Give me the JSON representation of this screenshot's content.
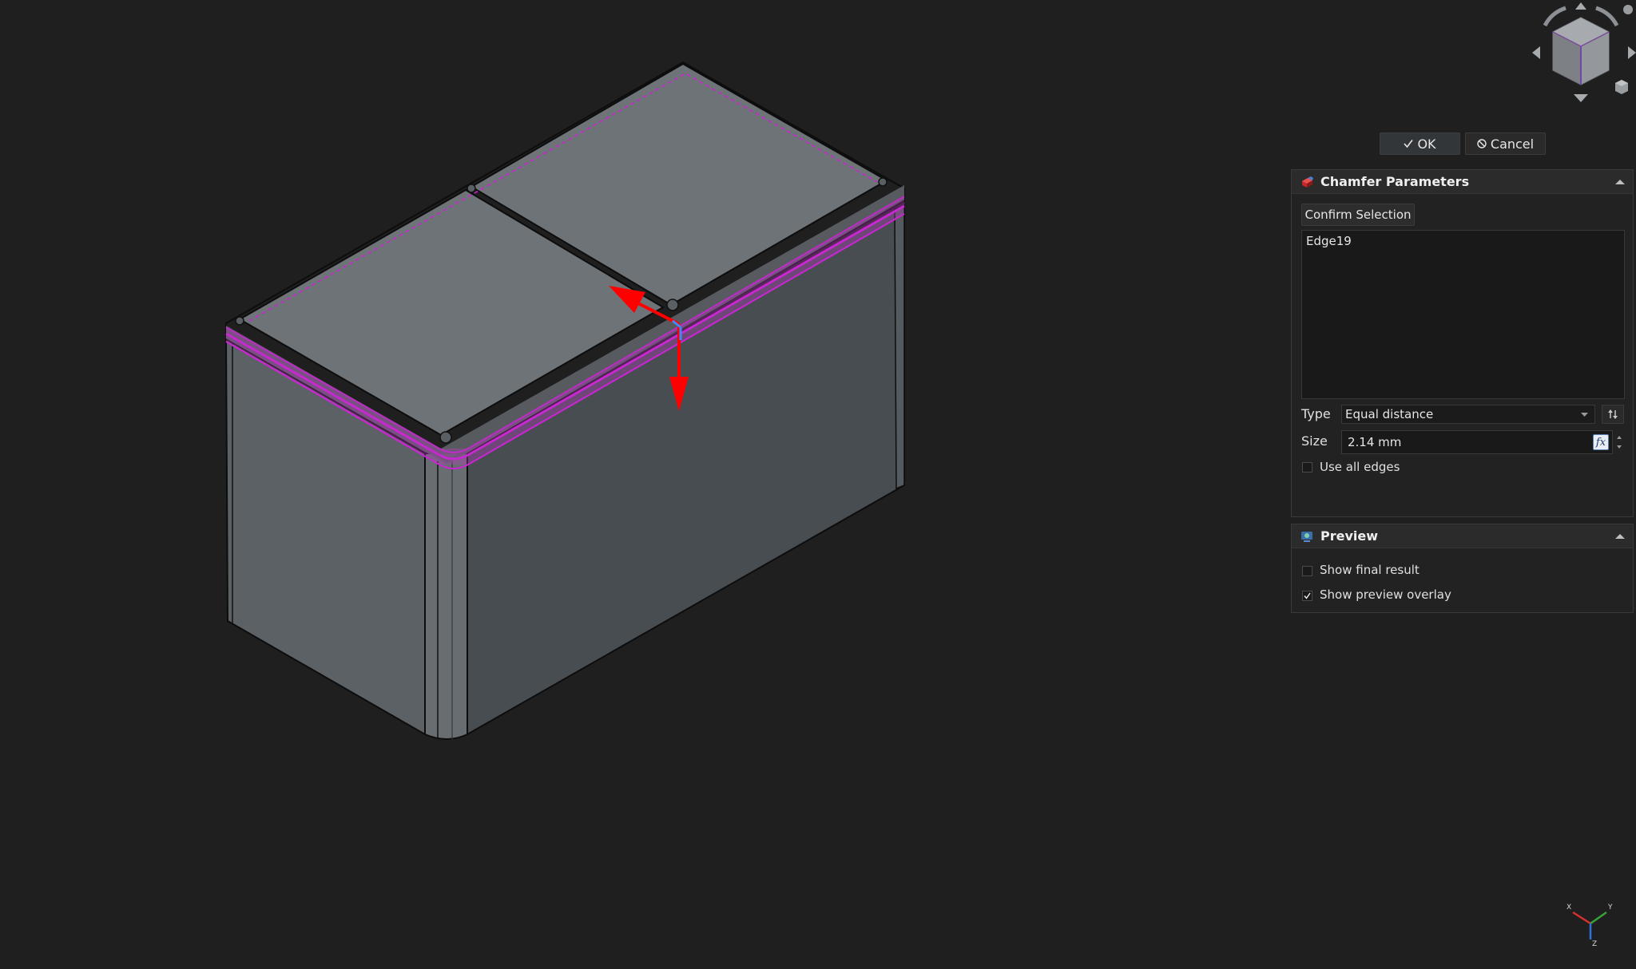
{
  "dialog": {
    "ok_label": "OK",
    "cancel_label": "Cancel"
  },
  "chamfer_panel": {
    "title": "Chamfer Parameters",
    "confirm_button": "Confirm Selection",
    "selected_edges": [
      "Edge19"
    ],
    "type_label": "Type",
    "type_value": "Equal distance",
    "size_label": "Size",
    "size_value": "2.14 mm",
    "fx_label": "fx",
    "use_all_edges_label": "Use all edges",
    "use_all_edges_checked": false
  },
  "preview_panel": {
    "title": "Preview",
    "show_final_result_label": "Show final result",
    "show_final_result_checked": false,
    "show_preview_overlay_label": "Show preview overlay",
    "show_preview_overlay_checked": true
  },
  "triad": {
    "x_label": "X",
    "y_label": "Y",
    "z_label": "Z"
  },
  "icons": {
    "ok": "checkmark-icon",
    "cancel": "forbidden-icon",
    "chamfer": "chamfer-feature-icon",
    "preview": "preview-icon",
    "collapse": "chevron-up-icon",
    "swap": "swap-direction-icon"
  },
  "colors": {
    "background": "#1f1f1f",
    "model_top": "#6e7378",
    "model_front": "#484d52",
    "model_side": "#5f6468",
    "selection_highlight": "#d020d8",
    "dragger": "#ff0000",
    "dragger_axis": "#3c8cff"
  }
}
